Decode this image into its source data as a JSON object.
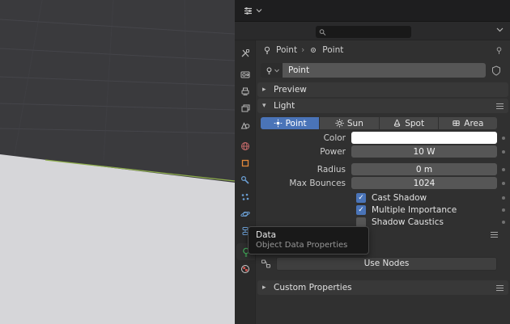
{
  "colors": {
    "accent": "#4a74b8",
    "field": "#565656",
    "bg": "#303030",
    "panelhead": "#383838",
    "swatch": "#ffffff"
  },
  "header": {
    "search_placeholder": ""
  },
  "tab_icons": [
    "tool",
    "render",
    "output",
    "view-layer",
    "scene",
    "world",
    "object",
    "modifiers",
    "particles",
    "physics",
    "constraints",
    "object-data",
    "material"
  ],
  "breadcrumb": {
    "object": "Point",
    "separator": "›",
    "data": "Point"
  },
  "id_block": {
    "name": "Point"
  },
  "panels": {
    "preview": {
      "label": "Preview",
      "arrow": "▸"
    },
    "light": {
      "label": "Light",
      "arrow": "▾",
      "types": [
        {
          "label": "Point",
          "selected": true
        },
        {
          "label": "Sun",
          "selected": false
        },
        {
          "label": "Spot",
          "selected": false
        },
        {
          "label": "Area",
          "selected": false
        }
      ],
      "fields": [
        {
          "label": "Color"
        },
        {
          "label": "Power",
          "value": "10 W"
        },
        {
          "label": "Radius",
          "value": "0 m"
        },
        {
          "label": "Max Bounces",
          "value": "1024"
        }
      ],
      "checks": [
        {
          "label": "Cast Shadow",
          "checked": true
        },
        {
          "label": "Multiple Importance",
          "checked": true
        },
        {
          "label": "Shadow Caustics",
          "checked": false
        }
      ]
    },
    "nodes": {
      "button": "Use Nodes"
    },
    "custom": {
      "label": "Custom Properties",
      "arrow": "▸"
    }
  },
  "tooltip": {
    "title": "Data",
    "subtitle": "Object Data Properties"
  }
}
